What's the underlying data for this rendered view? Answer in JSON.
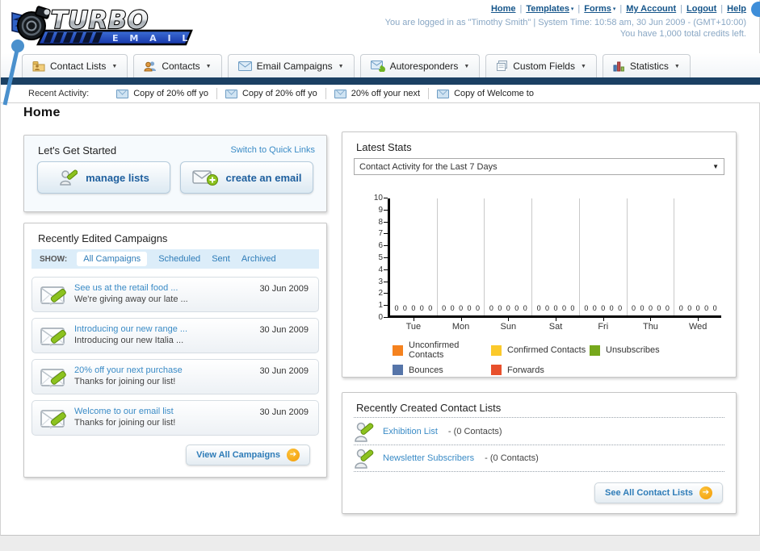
{
  "colors": {
    "navy_bar": "#1B4063",
    "link_blue": "#3A8BC6",
    "top_link_blue": "#15558A",
    "arrow_orange": "#F5A511",
    "pin_blue": "#4A90CD"
  },
  "header": {
    "logo_turbo": "TURBO",
    "logo_email": "E M A I L",
    "nav_links": [
      {
        "label": "Home",
        "caret": false
      },
      {
        "label": "Templates",
        "caret": true
      },
      {
        "label": "Forms",
        "caret": true
      },
      {
        "label": "My Account",
        "caret": false
      },
      {
        "label": "Logout",
        "caret": false
      },
      {
        "label": "Help",
        "caret": false
      }
    ],
    "login_line": "You are logged in as \"Timothy Smith\" | System Time: 10:58 am, 30 Jun 2009 - (GMT+10:00)",
    "credits_line": "You have 1,000 total credits left."
  },
  "nav_tabs": [
    {
      "label": "Contact Lists",
      "icon": "folder-user-icon"
    },
    {
      "label": "Contacts",
      "icon": "people-icon"
    },
    {
      "label": "Email Campaigns",
      "icon": "envelope-icon"
    },
    {
      "label": "Autoresponders",
      "icon": "envelope-arrow-icon"
    },
    {
      "label": "Custom Fields",
      "icon": "documents-icon"
    },
    {
      "label": "Statistics",
      "icon": "bar-chart-icon"
    }
  ],
  "recent_activity": {
    "label": "Recent Activity:",
    "items": [
      "Copy of 20% off yo",
      "Copy of 20% off yo",
      "20% off your next",
      "Copy of Welcome to"
    ]
  },
  "page_title": "Home",
  "get_started": {
    "title": "Let's Get Started",
    "switch_link": "Switch to Quick Links",
    "manage_lists_label": "manage lists",
    "create_email_label": "create an email"
  },
  "campaigns": {
    "title": "Recently Edited Campaigns",
    "show_label": "SHOW:",
    "filters": [
      "All Campaigns",
      "Scheduled",
      "Sent",
      "Archived"
    ],
    "active_filter": "All Campaigns",
    "rows": [
      {
        "title": "See us at the retail food ...",
        "subtitle": "We're giving away our late ...",
        "date": "30 Jun 2009"
      },
      {
        "title": "Introducing our new range ...",
        "subtitle": "Introducing our new Italia ...",
        "date": "30 Jun 2009"
      },
      {
        "title": "20% off your next purchase",
        "subtitle": "Thanks for joining our list!",
        "date": "30 Jun 2009"
      },
      {
        "title": "Welcome to our email list",
        "subtitle": "Thanks for joining our list!",
        "date": "30 Jun 2009"
      }
    ],
    "view_all_label": "View All Campaigns"
  },
  "latest_stats": {
    "title": "Latest Stats",
    "dropdown_value": "Contact Activity for the Last 7 Days"
  },
  "chart_data": {
    "type": "bar",
    "title": "Contact Activity for the Last 7 Days",
    "categories": [
      "Tue",
      "Mon",
      "Sun",
      "Sat",
      "Fri",
      "Thu",
      "Wed"
    ],
    "series": [
      {
        "name": "Unconfirmed Contacts",
        "color": "#F5821F",
        "values": [
          0,
          0,
          0,
          0,
          0,
          0,
          0
        ]
      },
      {
        "name": "Confirmed Contacts",
        "color": "#FBC92B",
        "values": [
          0,
          0,
          0,
          0,
          0,
          0,
          0
        ]
      },
      {
        "name": "Unsubscribes",
        "color": "#76A81C",
        "values": [
          0,
          0,
          0,
          0,
          0,
          0,
          0
        ]
      },
      {
        "name": "Bounces",
        "color": "#5675A9",
        "values": [
          0,
          0,
          0,
          0,
          0,
          0,
          0
        ]
      },
      {
        "name": "Forwards",
        "color": "#E8502C",
        "values": [
          0,
          0,
          0,
          0,
          0,
          0,
          0
        ]
      }
    ],
    "ylim": [
      0,
      10
    ],
    "yticks": [
      0,
      1,
      2,
      3,
      4,
      5,
      6,
      7,
      8,
      9,
      10
    ],
    "grid": "vertical",
    "legend_position": "bottom"
  },
  "contact_lists": {
    "title": "Recently Created Contact Lists",
    "rows": [
      {
        "name": "Exhibition List",
        "count": "- (0 Contacts)"
      },
      {
        "name": "Newsletter Subscribers",
        "count": "- (0 Contacts)"
      }
    ],
    "see_all_label": "See All Contact Lists"
  }
}
